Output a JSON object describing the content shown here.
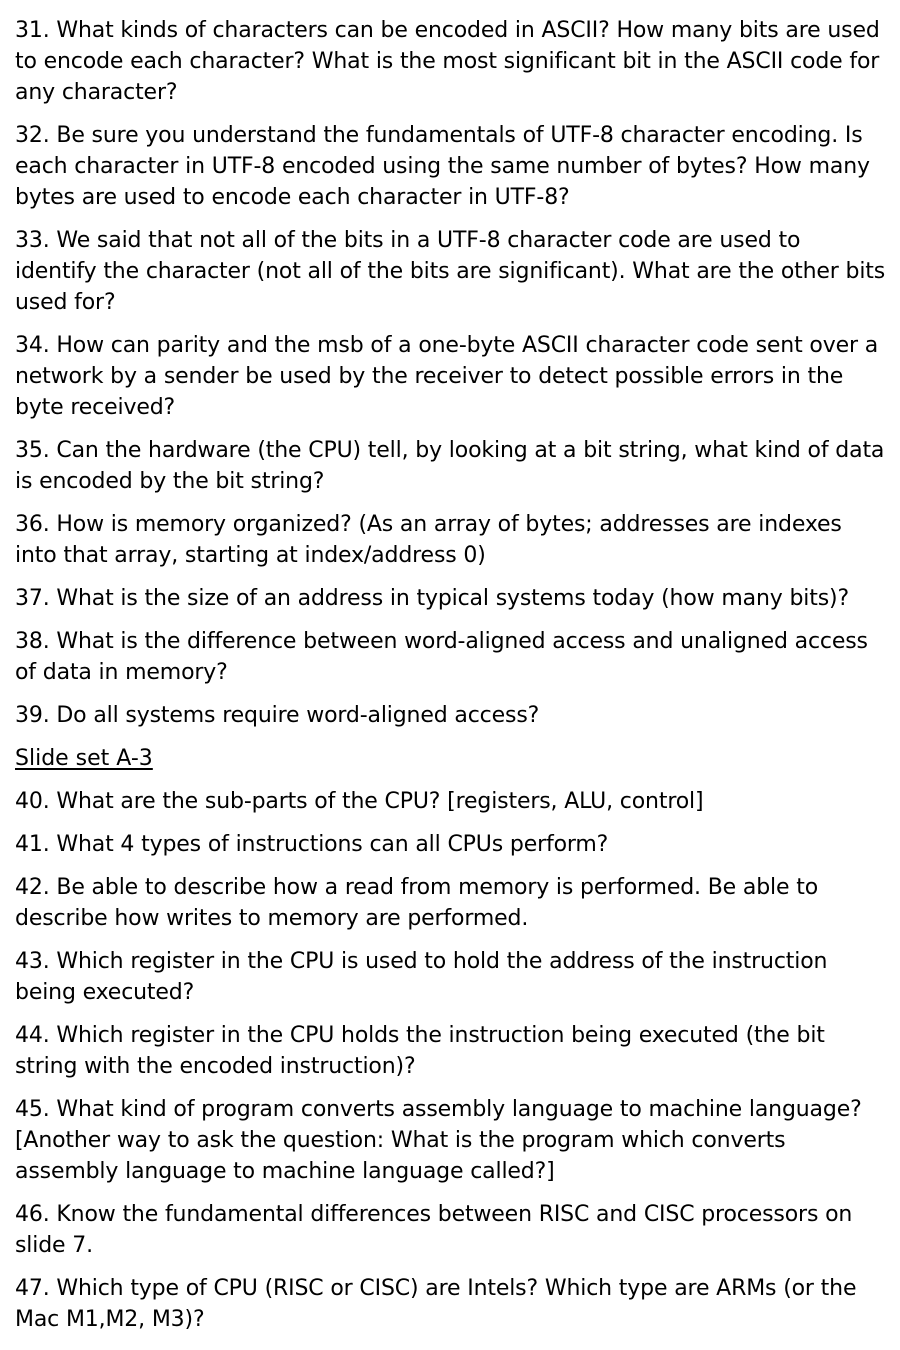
{
  "questions_a": [
    "31. What kinds of characters can be encoded in ASCII? How many bits are used to encode each character? What is the most significant bit in the ASCII code for any character?",
    "32. Be sure you understand the fundamentals of UTF-8 character encoding. Is each character in UTF-8 encoded using the same number of bytes? How many bytes are used to encode each character in UTF-8?",
    "33. We said that not all of the bits in a UTF-8 character code are used to identify the character (not all of the bits are significant). What are the other bits used for?",
    "34. How can parity and the msb of a one-byte ASCII character code sent over a network by a sender be used by the receiver to detect possible errors in the byte received?",
    "35. Can the hardware (the CPU) tell, by looking at a bit string, what kind of data is encoded by the bit string?",
    "36. How is memory organized? (As an array of bytes; addresses are indexes into that array, starting at index/address 0)",
    "37. What is the size of an address in typical systems today (how many bits)?",
    "38. What is the difference between word-aligned access and unaligned access of data in memory?",
    "39. Do all systems require word-aligned access?"
  ],
  "section_heading": "Slide set A-3",
  "questions_b": [
    "40. What are the sub-parts of the CPU? [registers, ALU, control]",
    "41. What 4 types of instructions can all CPUs perform?",
    "42. Be able to describe how a read from memory is performed. Be able to describe how writes to memory are performed.",
    "43. Which register in the CPU is used to hold the address of the instruction being executed?",
    "44. Which register in the CPU holds the instruction being executed (the bit string with the encoded instruction)?",
    "45. What kind of program converts assembly language to machine language? [Another way to ask the question: What is the program which converts assembly language to machine language called?]",
    "46. Know the fundamental differences between RISC and CISC processors on slide 7.",
    "47. Which type of CPU (RISC or CISC) are Intels? Which type are ARMs (or the Mac M1,M2, M3)?"
  ]
}
